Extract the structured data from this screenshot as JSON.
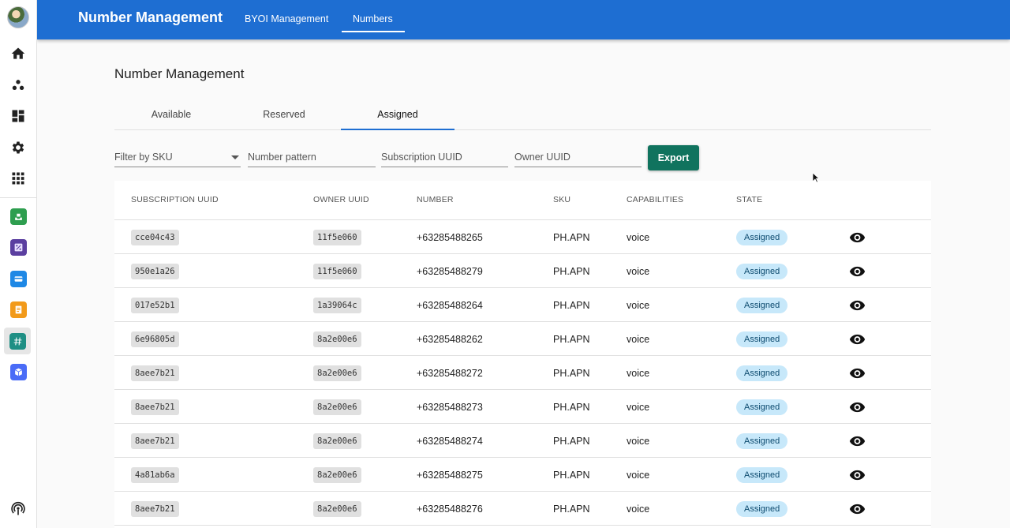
{
  "topbar": {
    "title": "Number Management",
    "nav": [
      "BYOI Management",
      "Numbers"
    ]
  },
  "page": {
    "title": "Number Management",
    "tabs": [
      "Available",
      "Reserved",
      "Assigned"
    ]
  },
  "filters": {
    "sku_label": "Filter by SKU",
    "number_placeholder": "Number pattern",
    "subscription_placeholder": "Subscription UUID",
    "owner_placeholder": "Owner UUID",
    "export_label": "Export"
  },
  "table": {
    "headers": [
      "SUBSCRIPTION UUID",
      "OWNER UUID",
      "NUMBER",
      "SKU",
      "CAPABILITIES",
      "STATE"
    ],
    "rows": [
      {
        "sub": "cce04c43",
        "owner": "11f5e060",
        "number": "+63285488265",
        "sku": "PH.APN",
        "cap": "voice",
        "state": "Assigned"
      },
      {
        "sub": "950e1a26",
        "owner": "11f5e060",
        "number": "+63285488279",
        "sku": "PH.APN",
        "cap": "voice",
        "state": "Assigned"
      },
      {
        "sub": "017e52b1",
        "owner": "1a39064c",
        "number": "+63285488264",
        "sku": "PH.APN",
        "cap": "voice",
        "state": "Assigned"
      },
      {
        "sub": "6e96805d",
        "owner": "8a2e00e6",
        "number": "+63285488262",
        "sku": "PH.APN",
        "cap": "voice",
        "state": "Assigned"
      },
      {
        "sub": "8aee7b21",
        "owner": "8a2e00e6",
        "number": "+63285488272",
        "sku": "PH.APN",
        "cap": "voice",
        "state": "Assigned"
      },
      {
        "sub": "8aee7b21",
        "owner": "8a2e00e6",
        "number": "+63285488273",
        "sku": "PH.APN",
        "cap": "voice",
        "state": "Assigned"
      },
      {
        "sub": "8aee7b21",
        "owner": "8a2e00e6",
        "number": "+63285488274",
        "sku": "PH.APN",
        "cap": "voice",
        "state": "Assigned"
      },
      {
        "sub": "4a81ab6a",
        "owner": "8a2e00e6",
        "number": "+63285488275",
        "sku": "PH.APN",
        "cap": "voice",
        "state": "Assigned"
      },
      {
        "sub": "8aee7b21",
        "owner": "8a2e00e6",
        "number": "+63285488276",
        "sku": "PH.APN",
        "cap": "voice",
        "state": "Assigned"
      }
    ]
  },
  "rail": {
    "icons": [
      "home-icon",
      "people-icon",
      "dashboard-icon",
      "settings-icon",
      "apps-grid-icon"
    ],
    "apps": [
      {
        "icon": "inbox-app-icon",
        "color": "#2e9e4f"
      },
      {
        "icon": "percent-app-icon",
        "color": "#5b3fa0"
      },
      {
        "icon": "card-app-icon",
        "color": "#1e88e5"
      },
      {
        "icon": "notes-app-icon",
        "color": "#f29a1a"
      },
      {
        "icon": "hashtag-app-icon",
        "color": "#1f8f84"
      },
      {
        "icon": "box-app-icon",
        "color": "#4a6cf7"
      }
    ],
    "bottom_icon": "broadcast-icon"
  },
  "colors": {
    "primary": "#1e6ed2",
    "export": "#10735e",
    "badge_bg": "#c7e8fa"
  }
}
